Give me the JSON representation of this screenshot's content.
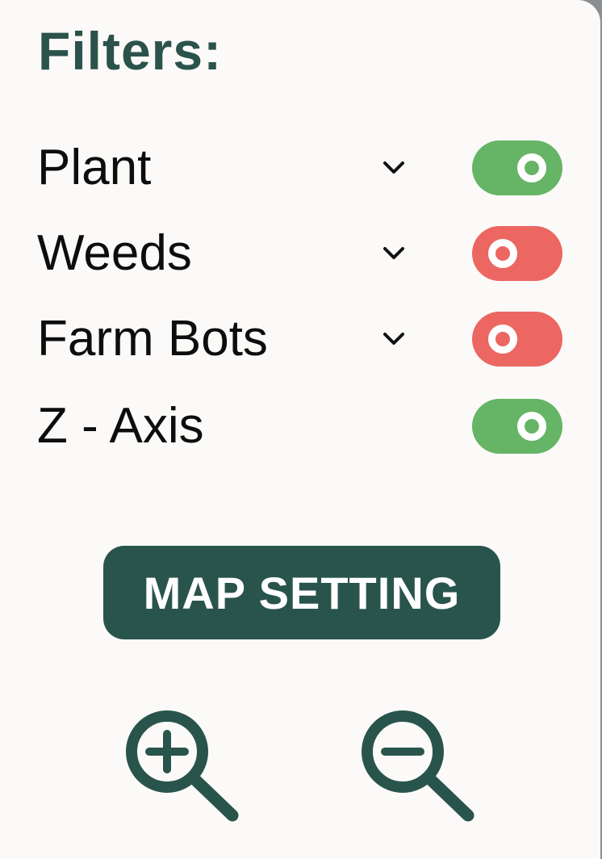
{
  "panel": {
    "title": "Filters:",
    "filters": [
      {
        "label": "Plant",
        "has_dropdown": true,
        "enabled": true
      },
      {
        "label": "Weeds",
        "has_dropdown": true,
        "enabled": false
      },
      {
        "label": "Farm Bots",
        "has_dropdown": true,
        "enabled": false
      },
      {
        "label": "Z - Axis",
        "has_dropdown": false,
        "enabled": true
      }
    ],
    "map_setting_label": "MAP SETTING",
    "zoom_in_icon": "zoom-in-icon",
    "zoom_out_icon": "zoom-out-icon"
  },
  "colors": {
    "brand": "#29544c",
    "toggle_on": "#66b466",
    "toggle_off": "#ec6662",
    "panel_bg": "#fbfaf8"
  }
}
